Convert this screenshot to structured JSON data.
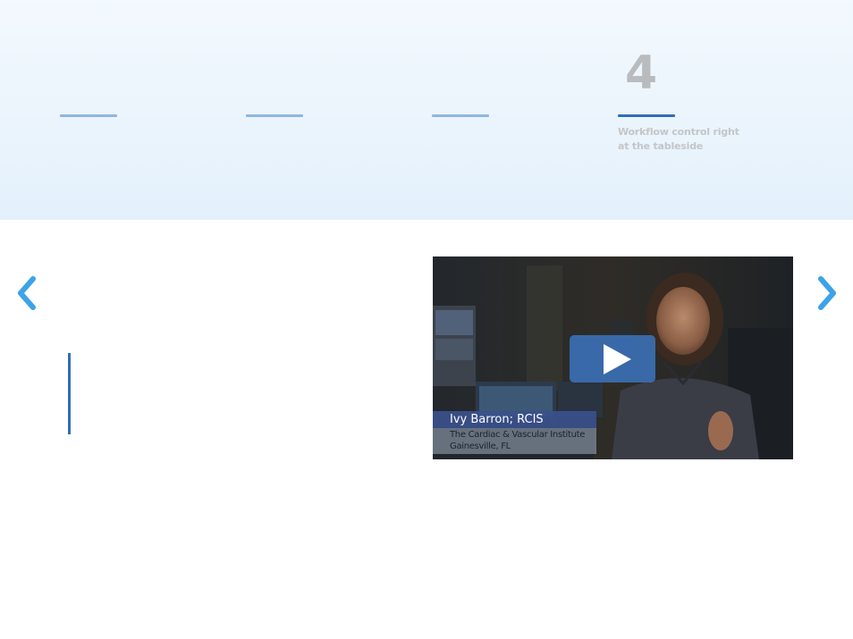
{
  "steps": [
    {
      "number": "",
      "caption": "",
      "active": false
    },
    {
      "number": "",
      "caption": "",
      "active": false
    },
    {
      "number": "",
      "caption": "",
      "active": false
    },
    {
      "number": "4",
      "caption": "Workflow control right at the tableside",
      "active": true
    }
  ],
  "carousel": {
    "prev_icon": "chevron-left-icon",
    "next_icon": "chevron-right-icon",
    "accent_color": "#3da3e8"
  },
  "video": {
    "play_icon": "play-icon",
    "lower_third": {
      "name": "Ivy Barron; RCIS",
      "organization": "The Cardiac & Vascular Institute",
      "location": "Gainesville, FL"
    }
  },
  "colors": {
    "header_bg": "#eaf4fc",
    "step_bar": "#8fb7e1",
    "step_bar_active": "#2f6eb8",
    "quote_bar": "#2f6eb8",
    "play_button": "#3b72ba"
  }
}
